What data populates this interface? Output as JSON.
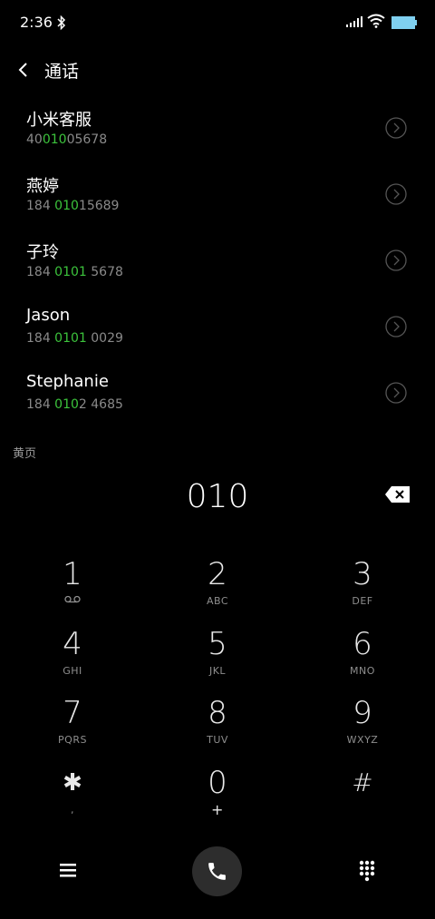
{
  "status": {
    "time": "2:36"
  },
  "header": {
    "title": "通话"
  },
  "contacts": [
    {
      "name": "小米客服",
      "num_pre": "40",
      "num_hl": "010",
      "num_post": "05678"
    },
    {
      "name": "燕婷",
      "num_pre": "184 ",
      "num_hl": "010",
      "num_post": "15689"
    },
    {
      "name": "子玲",
      "num_pre": "184 ",
      "num_hl": "0101",
      "num_post": " 5678"
    },
    {
      "name": "Jason",
      "num_pre": "184 ",
      "num_hl": "0101",
      "num_post": " 0029"
    },
    {
      "name": "Stephanie",
      "num_pre": "184 ",
      "num_hl": "010",
      "num_post": "2 4685"
    }
  ],
  "yellow_pages_label": "黄页",
  "dialer": {
    "input": "010"
  },
  "keys": [
    {
      "digit": "1",
      "letters": ""
    },
    {
      "digit": "2",
      "letters": "ABC"
    },
    {
      "digit": "3",
      "letters": "DEF"
    },
    {
      "digit": "4",
      "letters": "GHI"
    },
    {
      "digit": "5",
      "letters": "JKL"
    },
    {
      "digit": "6",
      "letters": "MNO"
    },
    {
      "digit": "7",
      "letters": "PQRS"
    },
    {
      "digit": "8",
      "letters": "TUV"
    },
    {
      "digit": "9",
      "letters": "WXYZ"
    },
    {
      "digit": "✱",
      "letters": ","
    },
    {
      "digit": "0",
      "letters": "+"
    },
    {
      "digit": "#",
      "letters": ""
    }
  ],
  "colors": {
    "highlight": "#3cc33c",
    "background": "#000000",
    "battery": "#7fd0f0",
    "call_button_bg": "#2d2d2d"
  },
  "icons": {
    "bluetooth": "bluetooth-icon",
    "signal": "signal-icon",
    "wifi": "wifi-icon",
    "battery": "battery-icon",
    "back": "back-arrow-icon",
    "detail": "chevron-circle-icon",
    "backspace": "backspace-icon",
    "voicemail": "voicemail-icon",
    "menu": "hamburger-menu-icon",
    "call": "phone-icon",
    "keypad": "keypad-grid-icon"
  }
}
